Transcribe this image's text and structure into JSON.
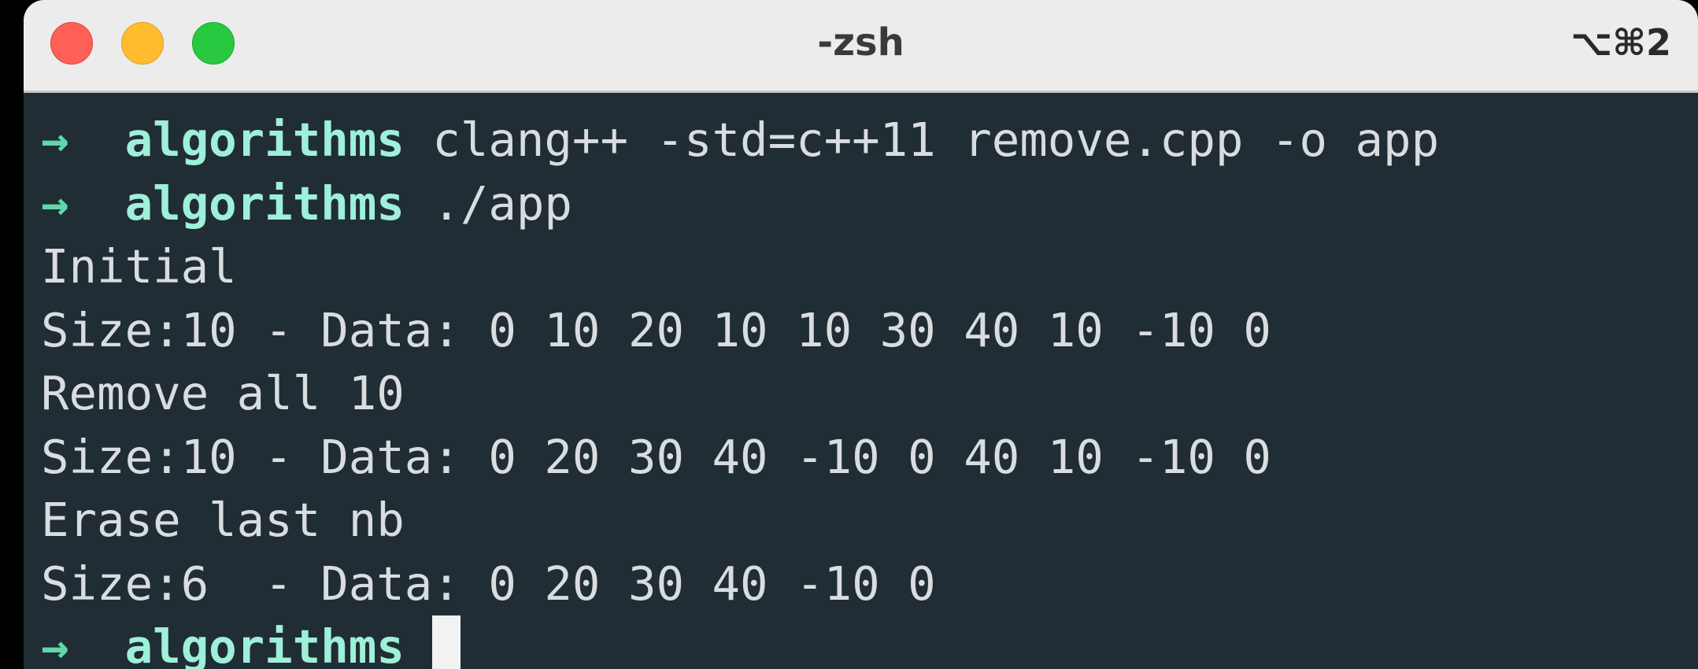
{
  "window": {
    "title": "-zsh",
    "shortcut": "⌥⌘2"
  },
  "terminal": {
    "prompt_arrow": "→",
    "prompt_dir": "algorithms",
    "lines": [
      {
        "type": "prompt",
        "command": "clang++ -std=c++11 remove.cpp -o app"
      },
      {
        "type": "prompt",
        "command": "./app"
      },
      {
        "type": "output",
        "text": "Initial"
      },
      {
        "type": "output",
        "text": "Size:10 - Data: 0 10 20 10 10 30 40 10 -10 0"
      },
      {
        "type": "output",
        "text": "Remove all 10"
      },
      {
        "type": "output",
        "text": "Size:10 - Data: 0 20 30 40 -10 0 40 10 -10 0"
      },
      {
        "type": "output",
        "text": "Erase last nb"
      },
      {
        "type": "output",
        "text": "Size:6  - Data: 0 20 30 40 -10 0"
      },
      {
        "type": "prompt",
        "command": ""
      }
    ]
  },
  "colors": {
    "background": "#212d34",
    "titlebar": "#ececec",
    "prompt_arrow": "#5fd7a7",
    "prompt_dir": "#9ef0d8",
    "text": "#d9dde0"
  }
}
